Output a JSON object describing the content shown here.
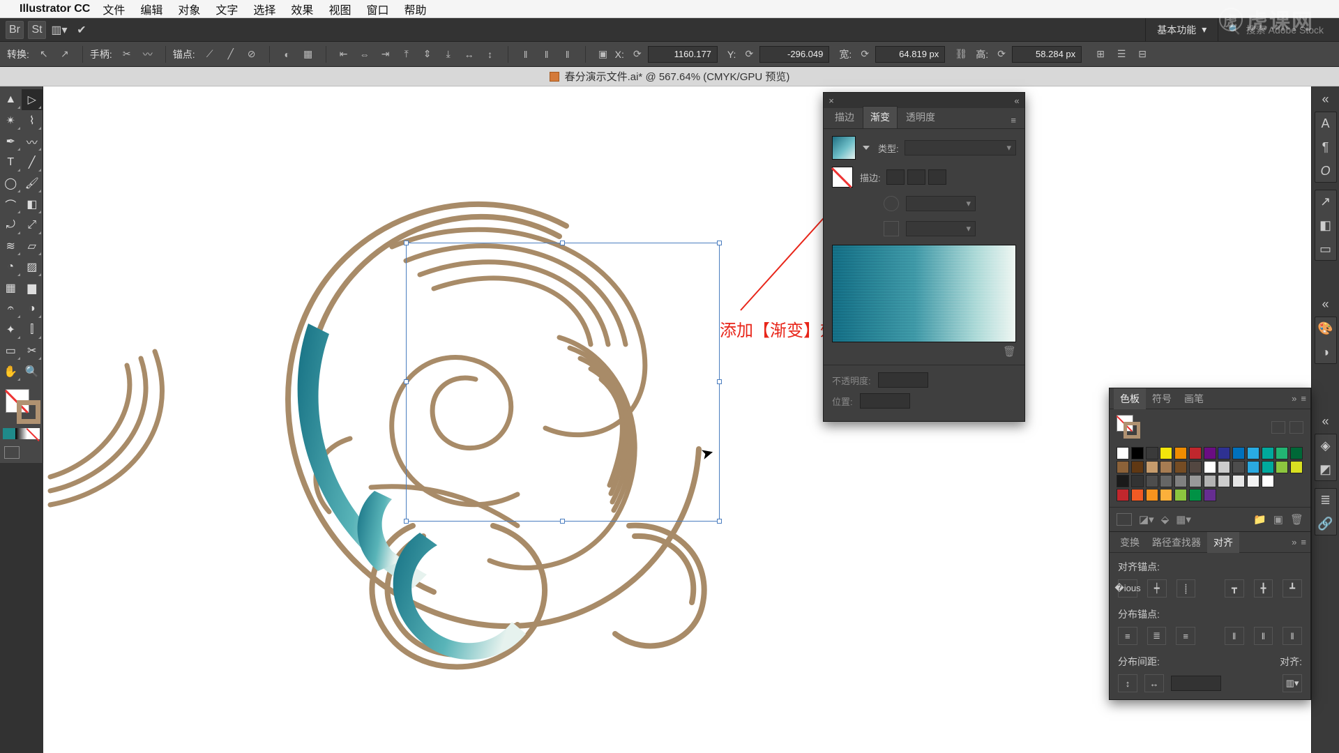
{
  "menubar": {
    "app": "Illustrator CC",
    "items": [
      "文件",
      "编辑",
      "对象",
      "文字",
      "选择",
      "效果",
      "视图",
      "窗口",
      "帮助"
    ]
  },
  "optionbar": {
    "essentials": "基本功能",
    "search_placeholder": "搜索 Adobe Stock"
  },
  "controlbar": {
    "transform_label": "转换:",
    "handle_label": "手柄:",
    "anchor_label": "锚点:",
    "x_label": "X:",
    "x_value": "1160.177",
    "y_label": "Y:",
    "y_value": "-296.049",
    "w_label": "宽:",
    "w_value": "64.819 px",
    "h_label": "高:",
    "h_value": "58.284 px"
  },
  "document": {
    "title": "春分演示文件.ai* @ 567.64% (CMYK/GPU 预览)"
  },
  "annotation": {
    "text": "添加【渐变】效果"
  },
  "gradient_panel": {
    "tabs": [
      "描边",
      "渐变",
      "透明度"
    ],
    "type_label": "类型:",
    "stroke_label": "描边:",
    "opacity_label": "不透明度:",
    "location_label": "位置:"
  },
  "swatch_panel": {
    "tabs": [
      "色板",
      "符号",
      "画笔"
    ],
    "colors_row1": [
      "#ffffff",
      "#000000",
      "#3a3a3a",
      "#f2e50b",
      "#f08c00",
      "#c1272d",
      "#6a0d82",
      "#2e3192",
      "#0071bc",
      "#29abe2",
      "#00a99d",
      "#22b573",
      "#006837"
    ],
    "colors_row2": [
      "#8c6239",
      "#603813",
      "#c69c6d",
      "#a67c52",
      "#754c24",
      "#534741",
      "#ffffff",
      "#cccccc",
      "#4d4d4d",
      "#2aa9e0",
      "#00a99d",
      "#8cc63f",
      "#d9e021"
    ],
    "colors_row3": [
      "#1a1a1a",
      "#333333",
      "#4d4d4d",
      "#666666",
      "#808080",
      "#999999",
      "#b3b3b3",
      "#cccccc",
      "#e6e6e6",
      "#f2f2f2",
      "#ffffff",
      "",
      ""
    ],
    "colors_row4": [
      "#c1272d",
      "#f15a24",
      "#f7931e",
      "#fbb03b",
      "#8cc63f",
      "#009245",
      "#662d91",
      "",
      "",
      "",
      "",
      "",
      ""
    ]
  },
  "align_panel": {
    "tabs": [
      "变换",
      "路径查找器",
      "对齐"
    ],
    "align_anchor_label": "对齐锚点:",
    "distribute_anchor_label": "分布锚点:",
    "distribute_spacing_label": "分布间距:",
    "align_to_label": "对齐:"
  },
  "watermark": "虎课网"
}
